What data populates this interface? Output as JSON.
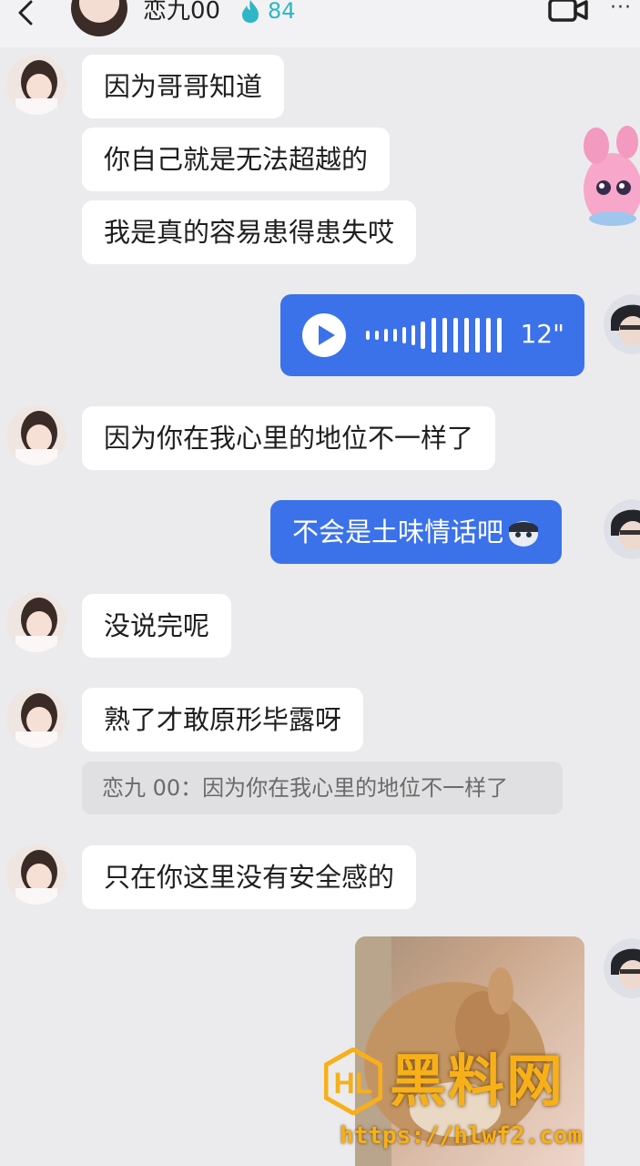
{
  "header": {
    "contact_name": "恋九00",
    "streak_count": "84",
    "accent_color": "#2fb6c6"
  },
  "messages": [
    {
      "side": "received",
      "text": "因为哥哥知道"
    },
    {
      "side": "received",
      "text": "你自己就是无法超越的"
    },
    {
      "side": "received",
      "text": "我是真的容易患得患失哎"
    },
    {
      "side": "sent",
      "type": "voice",
      "duration": "12\""
    },
    {
      "side": "received",
      "text": "因为你在我心里的地位不一样了"
    },
    {
      "side": "sent",
      "text": "不会是土味情话吧"
    },
    {
      "side": "received",
      "text": "没说完呢"
    },
    {
      "side": "received",
      "text": "熟了才敢原形毕露呀"
    },
    {
      "side": "received",
      "type": "quote",
      "text": "恋九 00：因为你在我心里的地位不一样了"
    },
    {
      "side": "received",
      "text": "只在你这里没有安全感的"
    },
    {
      "side": "sent",
      "type": "image"
    }
  ],
  "sent_bubble_color": "#3b72ea",
  "watermark": {
    "title": "黑料网",
    "url": "https://hlwf2.com"
  }
}
